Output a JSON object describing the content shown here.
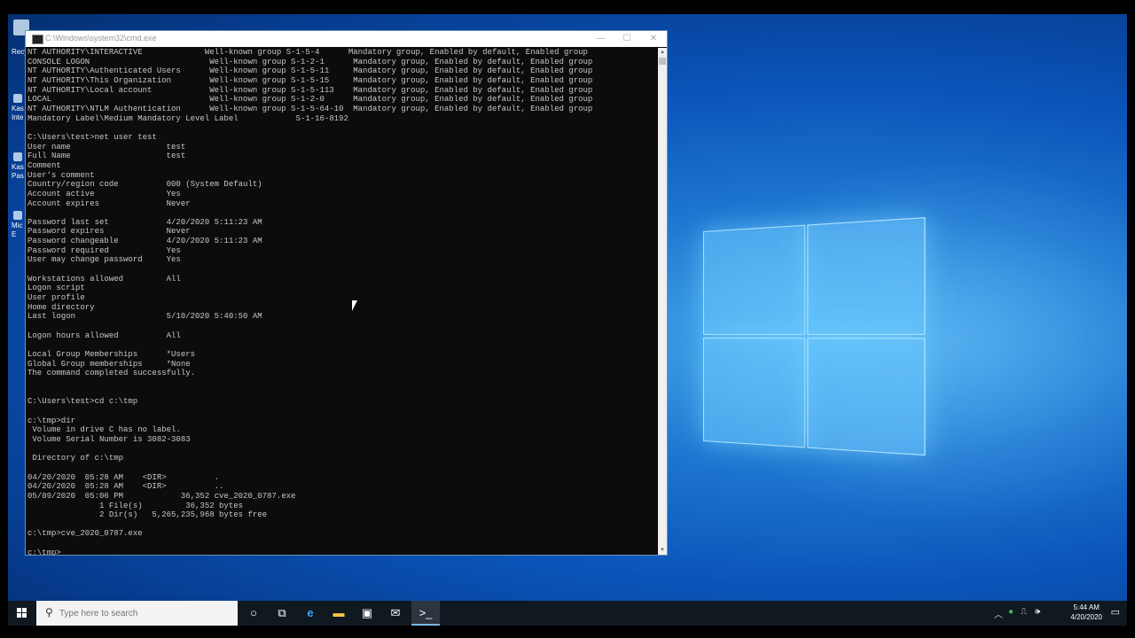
{
  "desktop": {
    "icons": [
      {
        "label": "Recy"
      },
      {
        "label": "Kas"
      },
      {
        "label": "Inte"
      },
      {
        "label": "Kas"
      },
      {
        "label": "Pas"
      },
      {
        "label": "Mic"
      },
      {
        "label": "E"
      }
    ]
  },
  "cmd_window": {
    "title": "C:\\Windows\\system32\\cmd.exe",
    "controls": {
      "minimize": "—",
      "maximize": "☐",
      "close": "✕"
    },
    "lines": [
      "NT AUTHORITY\\INTERACTIVE             Well-known group S-1-5-4      Mandatory group, Enabled by default, Enabled group",
      "CONSOLE LOGON                         Well-known group S-1-2-1      Mandatory group, Enabled by default, Enabled group",
      "NT AUTHORITY\\Authenticated Users      Well-known group S-1-5-11     Mandatory group, Enabled by default, Enabled group",
      "NT AUTHORITY\\This Organization        Well-known group S-1-5-15     Mandatory group, Enabled by default, Enabled group",
      "NT AUTHORITY\\Local account            Well-known group S-1-5-113    Mandatory group, Enabled by default, Enabled group",
      "LOCAL                                 Well-known group S-1-2-0      Mandatory group, Enabled by default, Enabled group",
      "NT AUTHORITY\\NTLM Authentication      Well-known group S-1-5-64-10  Mandatory group, Enabled by default, Enabled group",
      "Mandatory Label\\Medium Mandatory Level Label            S-1-16-8192",
      "",
      "C:\\Users\\test>net user test",
      "User name                    test",
      "Full Name                    test",
      "Comment",
      "User's comment",
      "Country/region code          000 (System Default)",
      "Account active               Yes",
      "Account expires              Never",
      "",
      "Password last set            ‎4/‎20/‎2020 5:11:23 AM",
      "Password expires             Never",
      "Password changeable          ‎4/‎20/‎2020 5:11:23 AM",
      "Password required            Yes",
      "User may change password     Yes",
      "",
      "Workstations allowed         All",
      "Logon script",
      "User profile",
      "Home directory",
      "Last logon                   ‎5/‎10/‎2020 5:40:50 AM",
      "",
      "Logon hours allowed          All",
      "",
      "Local Group Memberships      *Users",
      "Global Group memberships     *None",
      "The command completed successfully.",
      "",
      "",
      "C:\\Users\\test>cd c:\\tmp",
      "",
      "c:\\tmp>dir",
      " Volume in drive C has no label.",
      " Volume Serial Number is 3082-3083",
      "",
      " Directory of c:\\tmp",
      "",
      "04/20/2020  05:28 AM    <DIR>          .",
      "04/20/2020  05:28 AM    <DIR>          ..",
      "05/09/2020  05:06 PM            36,352 cve_2020_0787.exe",
      "               1 File(s)         36,352 bytes",
      "               2 Dir(s)   5,265,235,968 bytes free",
      "",
      "c:\\tmp>cve_2020_0787.exe",
      "",
      "c:\\tmp>"
    ]
  },
  "taskbar": {
    "search_placeholder": "Type here to search",
    "search_icon": "search-icon",
    "pinned": [
      {
        "name": "cortana-icon",
        "glyph": "○"
      },
      {
        "name": "task-view-icon",
        "glyph": "⧉"
      },
      {
        "name": "edge-icon",
        "glyph": "e"
      },
      {
        "name": "file-explorer-icon",
        "glyph": "▬"
      },
      {
        "name": "store-icon",
        "glyph": "▣"
      },
      {
        "name": "mail-icon",
        "glyph": "✉"
      },
      {
        "name": "cmd-icon",
        "glyph": ">_"
      }
    ],
    "tray": {
      "time": "5:44 AM",
      "date": "4/20/2020"
    }
  },
  "colors": {
    "console_bg": "#0c0c0c",
    "console_text": "#c8c8c8",
    "taskbar_bg": "#101820",
    "accent": "#0a54b8"
  }
}
